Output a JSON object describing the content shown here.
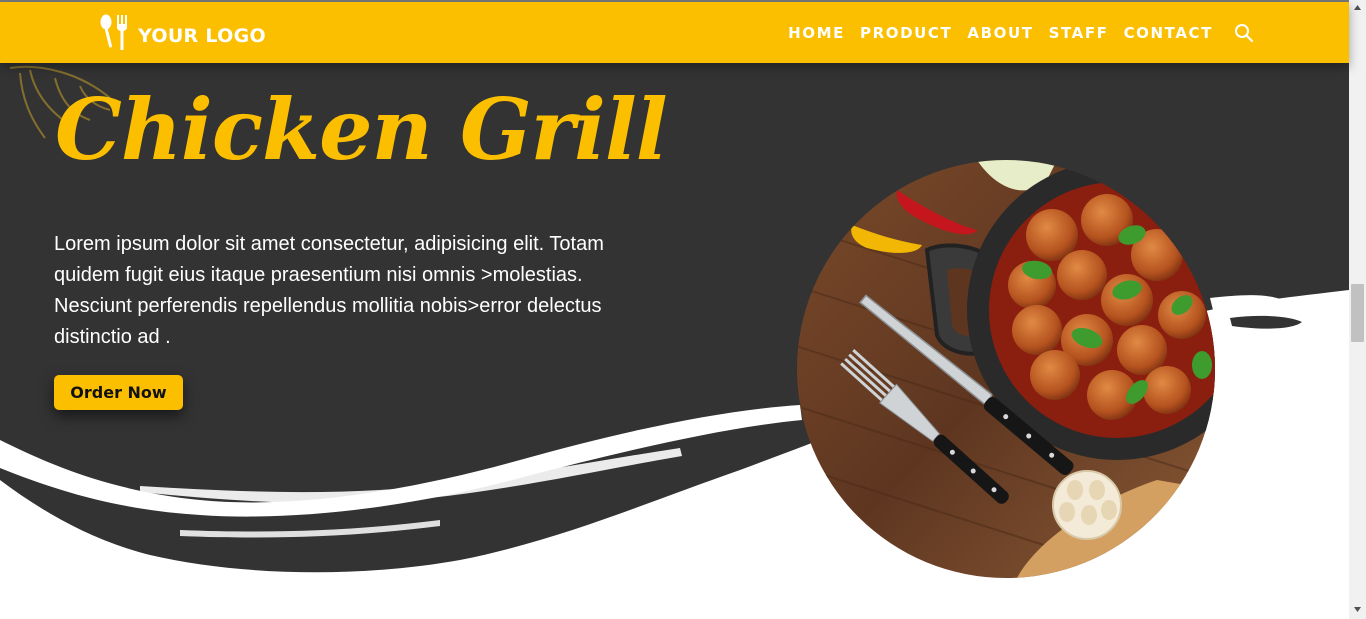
{
  "colors": {
    "accent": "#fbbf00",
    "hero_background": "#333333",
    "text_light": "#ffffff"
  },
  "header": {
    "logo_text": "YOUR LOGO",
    "logo_icon": "spoon-fork-icon",
    "nav": [
      {
        "label": "HOME"
      },
      {
        "label": "PRODUCT"
      },
      {
        "label": "ABOUT"
      },
      {
        "label": "STAFF"
      },
      {
        "label": "CONTACT"
      }
    ],
    "search_icon": "search-icon"
  },
  "hero": {
    "title": "Chicken Grill",
    "description": "Lorem ipsum dolor sit amet consectetur, adipisicing elit. Totam quidem fugit eius itaque praesentium nisi omnis >molestias. Nesciunt perferendis repellendus mollitia nobis>error delectus distinctio ad .",
    "cta_label": "Order Now",
    "image": "meatballs-skillet-photo"
  }
}
